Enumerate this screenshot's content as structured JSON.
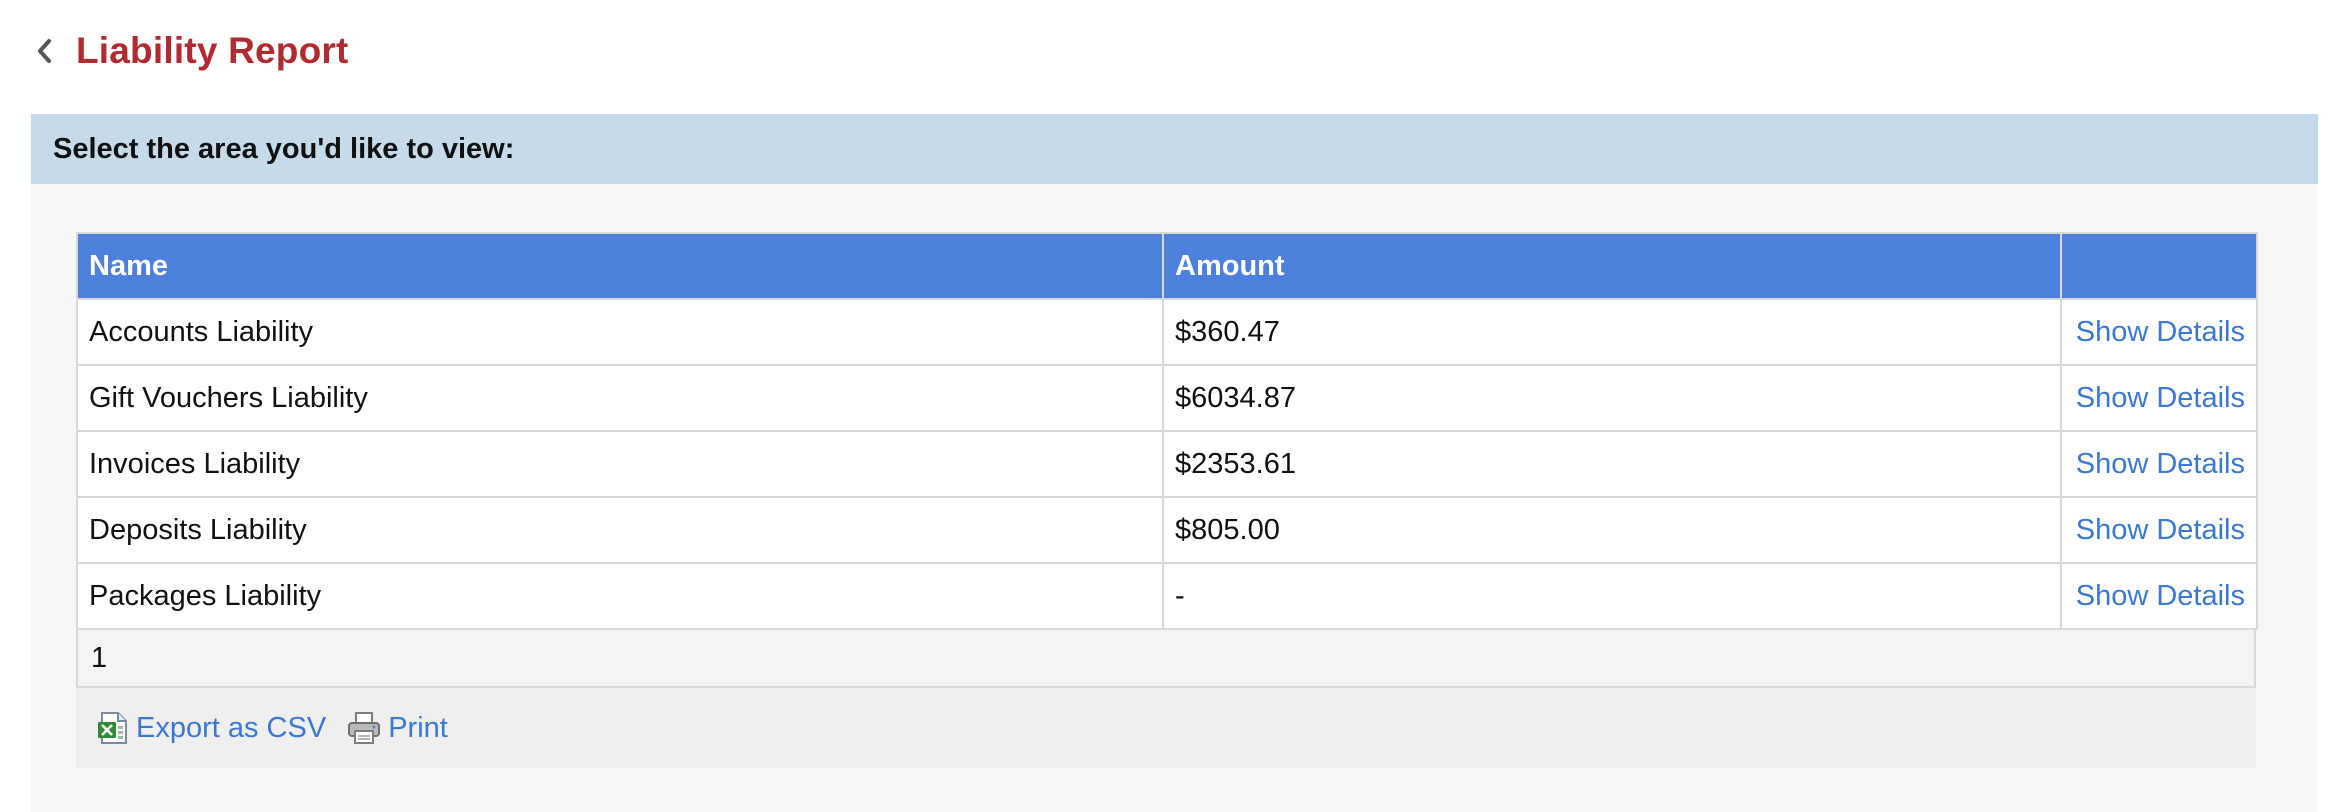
{
  "page": {
    "title": "Liability Report"
  },
  "panel": {
    "prompt": "Select the area you'd like to view:"
  },
  "table": {
    "columns": [
      "Name",
      "Amount",
      ""
    ],
    "rows": [
      {
        "name": "Accounts Liability",
        "amount": "$360.47",
        "action": "Show Details"
      },
      {
        "name": "Gift Vouchers Liability",
        "amount": "$6034.87",
        "action": "Show Details"
      },
      {
        "name": "Invoices Liability",
        "amount": "$2353.61",
        "action": "Show Details"
      },
      {
        "name": "Deposits Liability",
        "amount": "$805.00",
        "action": "Show Details"
      },
      {
        "name": "Packages Liability",
        "amount": "-",
        "action": "Show Details"
      }
    ],
    "page_number": "1"
  },
  "footer": {
    "export_label": "Export as CSV",
    "export_icon": "csv-file-icon",
    "print_label": "Print",
    "print_icon": "printer-icon"
  },
  "colors": {
    "title": "#b02a30",
    "header_band": "#c5dbea",
    "table_header": "#4c80dc",
    "link": "#3a78d4"
  }
}
